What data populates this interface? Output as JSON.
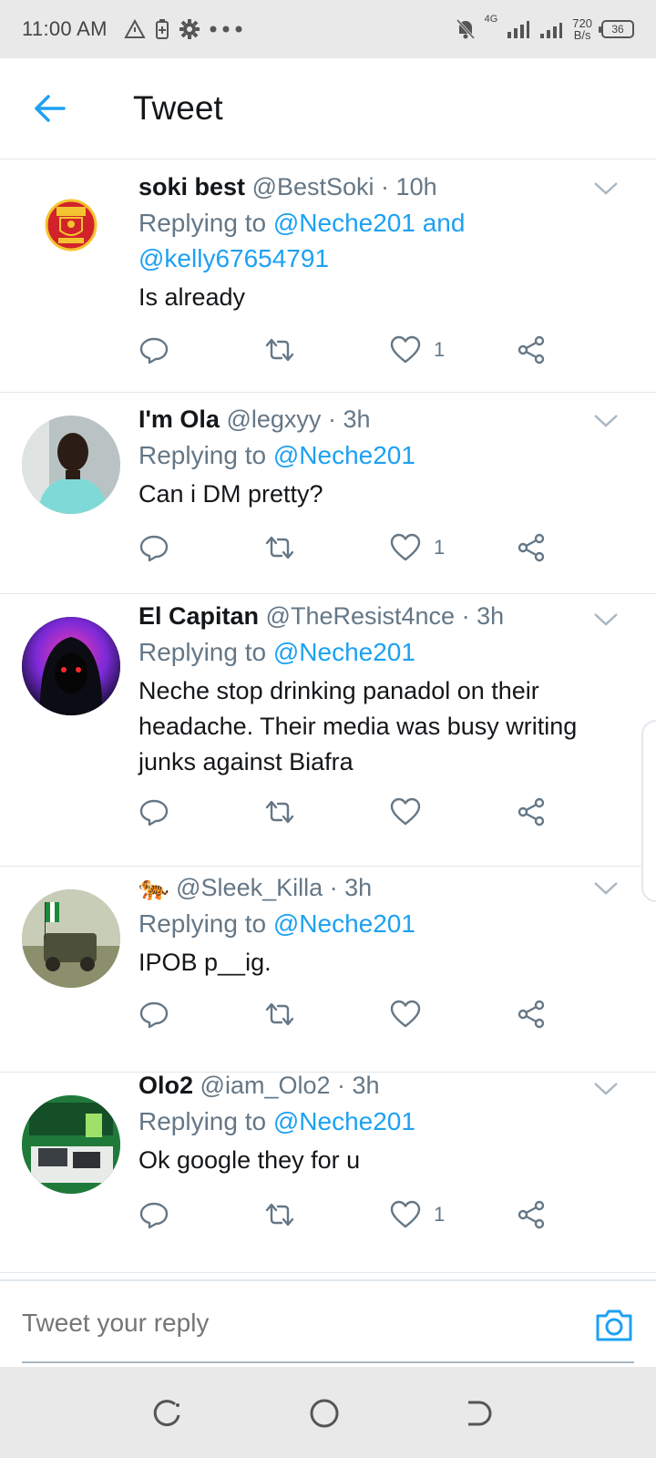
{
  "status_bar": {
    "time": "11:00 AM",
    "network_type": "4G",
    "speed_value": "720",
    "speed_unit": "B/s",
    "battery": "36"
  },
  "header": {
    "title": "Tweet"
  },
  "tweets": [
    {
      "name": "soki best",
      "handle": "@BestSoki",
      "time": "10h",
      "reply_prefix": "Replying to ",
      "mentions": "@Neche201 and @kelly67654791",
      "text": "Is already",
      "like_count": "1"
    },
    {
      "name": "I'm Ola",
      "handle": "@legxyy",
      "time": "3h",
      "reply_prefix": "Replying to ",
      "mentions": "@Neche201",
      "text": "Can i DM pretty?",
      "like_count": "1"
    },
    {
      "name": "El Capitan",
      "handle": "@TheResist4nce",
      "time": "3h",
      "reply_prefix": "Replying to ",
      "mentions": "@Neche201",
      "text": "Neche stop drinking panadol on their headache. Their media was busy writing junks against Biafra",
      "like_count": ""
    },
    {
      "name": "🐅",
      "handle": "@Sleek_Killa",
      "time": "3h",
      "reply_prefix": "Replying to ",
      "mentions": "@Neche201",
      "text": "IPOB p__ig.",
      "like_count": ""
    },
    {
      "name": "Olo2",
      "handle": "@iam_Olo2",
      "time": "3h",
      "reply_prefix": "Replying to ",
      "mentions": "@Neche201",
      "text": "Ok google they for u",
      "like_count": "1"
    }
  ],
  "reply_bar": {
    "placeholder": "Tweet your reply"
  },
  "icons": {
    "back": "arrow-left-icon",
    "chevron": "chevron-down-icon",
    "reply": "reply-icon",
    "retweet": "retweet-icon",
    "like": "heart-icon",
    "share": "share-icon",
    "camera": "camera-icon"
  },
  "colors": {
    "accent": "#1da1f2",
    "secondary_text": "#657786",
    "divider": "#e1e8ed"
  }
}
